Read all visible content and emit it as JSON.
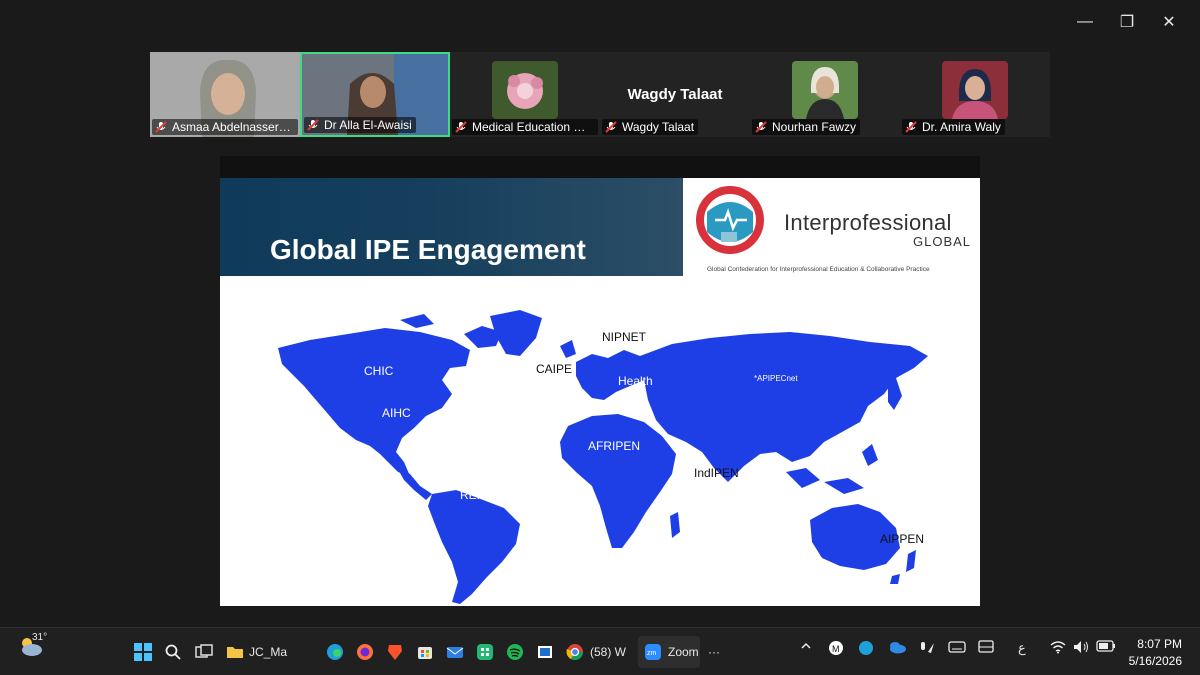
{
  "window_controls": {
    "minimize": "—",
    "restore": "❐",
    "close": "✕"
  },
  "participants": [
    {
      "name": "Asmaa Abdelnasser (D...",
      "mode": "video"
    },
    {
      "name": "Dr Alla El-Awaisi",
      "mode": "video",
      "active": true
    },
    {
      "name": "Medical Education De...",
      "mode": "avatar"
    },
    {
      "name": "Wagdy Talaat",
      "mode": "name_only",
      "display_name": "Wagdy Talaat"
    },
    {
      "name": "Nourhan Fawzy",
      "mode": "avatar"
    },
    {
      "name": "Dr. Amira Waly",
      "mode": "avatar"
    }
  ],
  "slide": {
    "title": "Global IPE Engagement",
    "logo_word": "Interprofessional",
    "logo_global": "GLOBAL",
    "logo_sub": "Global Confederation for Interprofessional Education & Collaborative Practice",
    "map_labels": {
      "chic": "CHIC",
      "aihc": "AIHC",
      "caipe": "CAIPE",
      "nipnet": "NIPNET",
      "health": "Health",
      "apipecnet": "*APIPECnet",
      "afripen": "AFRIPEN",
      "indipen": "IndIPEN",
      "reip": "REIP",
      "aippen": "AIPPEN"
    }
  },
  "taskbar": {
    "weather_temp": "31°",
    "jc_label": "JC_Ma",
    "chrome_label": "(58) W",
    "zoom_label": "Zoom",
    "more": "···",
    "lang": "ع",
    "time": "8:07 PM",
    "date": "5/16/2026"
  },
  "colors": {
    "map_blue": "#1f3fe6",
    "active_border": "#3ddc84",
    "mic_muted": "#e53935"
  }
}
